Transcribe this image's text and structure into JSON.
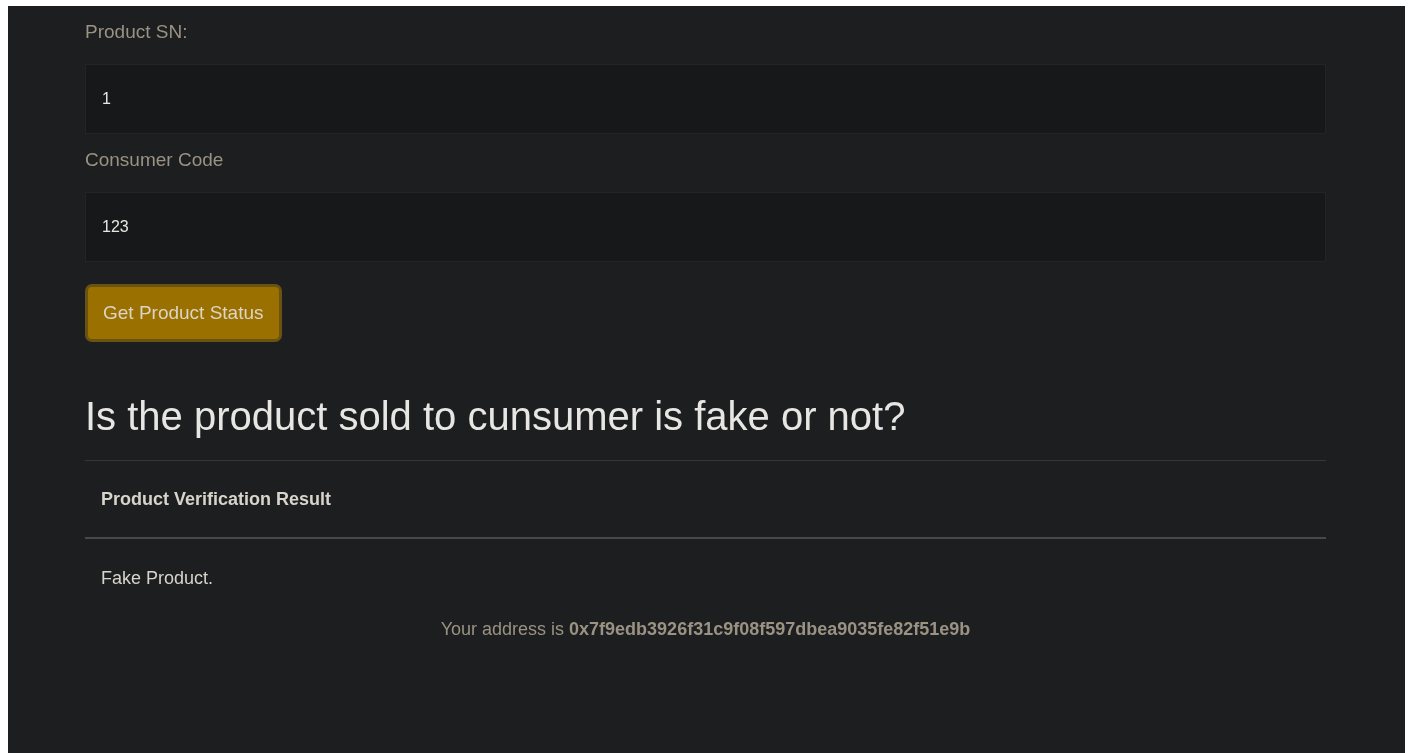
{
  "form": {
    "fields": [
      {
        "label": "Product SN:",
        "value": "1"
      },
      {
        "label": "Consumer Code",
        "value": "123"
      }
    ],
    "button": "Get Product Status"
  },
  "heading": "Is the product sold to cunsumer is fake or not?",
  "table": {
    "columns": [
      "Product Verification Result"
    ],
    "rows": [
      [
        "Fake Product."
      ]
    ]
  },
  "footer": "Your address is **0x7f9edb3926f31c9f08f597dbea9035fe82f51e9b**"
}
